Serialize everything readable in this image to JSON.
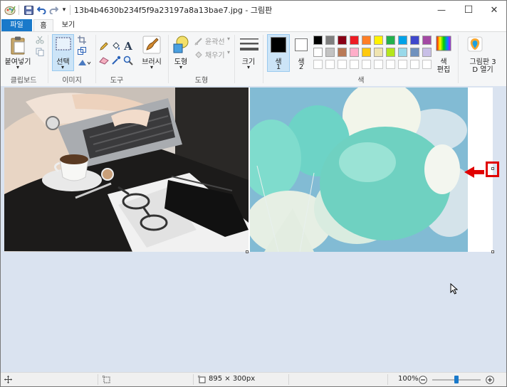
{
  "window": {
    "title": "13b4b4630b234f5f9a23197a8a13bae7.jpg - 그림판",
    "controls": {
      "minimize": "—",
      "maximize": "☐",
      "close": "✕"
    }
  },
  "quick_access": {
    "save": "save-icon",
    "undo": "undo-icon",
    "redo": "redo-icon",
    "customize": "▾"
  },
  "tabs": [
    {
      "label": "파일"
    },
    {
      "label": "홈"
    },
    {
      "label": "보기"
    }
  ],
  "ribbon": {
    "clipboard": {
      "group": "클립보드",
      "paste": "붙여넣기"
    },
    "image": {
      "group": "이미지",
      "select": "선택"
    },
    "tools": {
      "group": "도구",
      "text_glyph": "A"
    },
    "brushes": {
      "label": "브러시"
    },
    "shapes": {
      "group": "도형",
      "shapes_label": "도형",
      "outline": "윤곽선",
      "fill": "채우기"
    },
    "size": {
      "label": "크기"
    },
    "colors": {
      "group": "색",
      "color1_label": "색",
      "color1_num": "1",
      "color2_label": "색",
      "color2_num": "2",
      "edit_label_1": "색",
      "edit_label_2": "편집",
      "color1_value": "#000000",
      "color2_value": "#ffffff",
      "palette_row1": [
        "#000000",
        "#7f7f7f",
        "#880015",
        "#ed1c24",
        "#ff7f27",
        "#fff200",
        "#22b14c",
        "#00a2e8",
        "#3f48cc",
        "#a349a4"
      ],
      "palette_row2": [
        "#ffffff",
        "#c3c3c3",
        "#b97a57",
        "#ffaec9",
        "#ffc90e",
        "#efe4b0",
        "#b5e61d",
        "#99d9ea",
        "#7092be",
        "#c8bfe7"
      ],
      "palette_row3": [
        "#ffffff",
        "#ffffff",
        "#ffffff",
        "#ffffff",
        "#ffffff",
        "#ffffff",
        "#ffffff",
        "#ffffff",
        "#ffffff",
        "#ffffff"
      ]
    },
    "paint3d": {
      "line1": "그림판 3",
      "line2": "D 열기"
    }
  },
  "status": {
    "dimensions": "895 × 300px",
    "zoom": "100%",
    "zoom_level": 1.0
  }
}
